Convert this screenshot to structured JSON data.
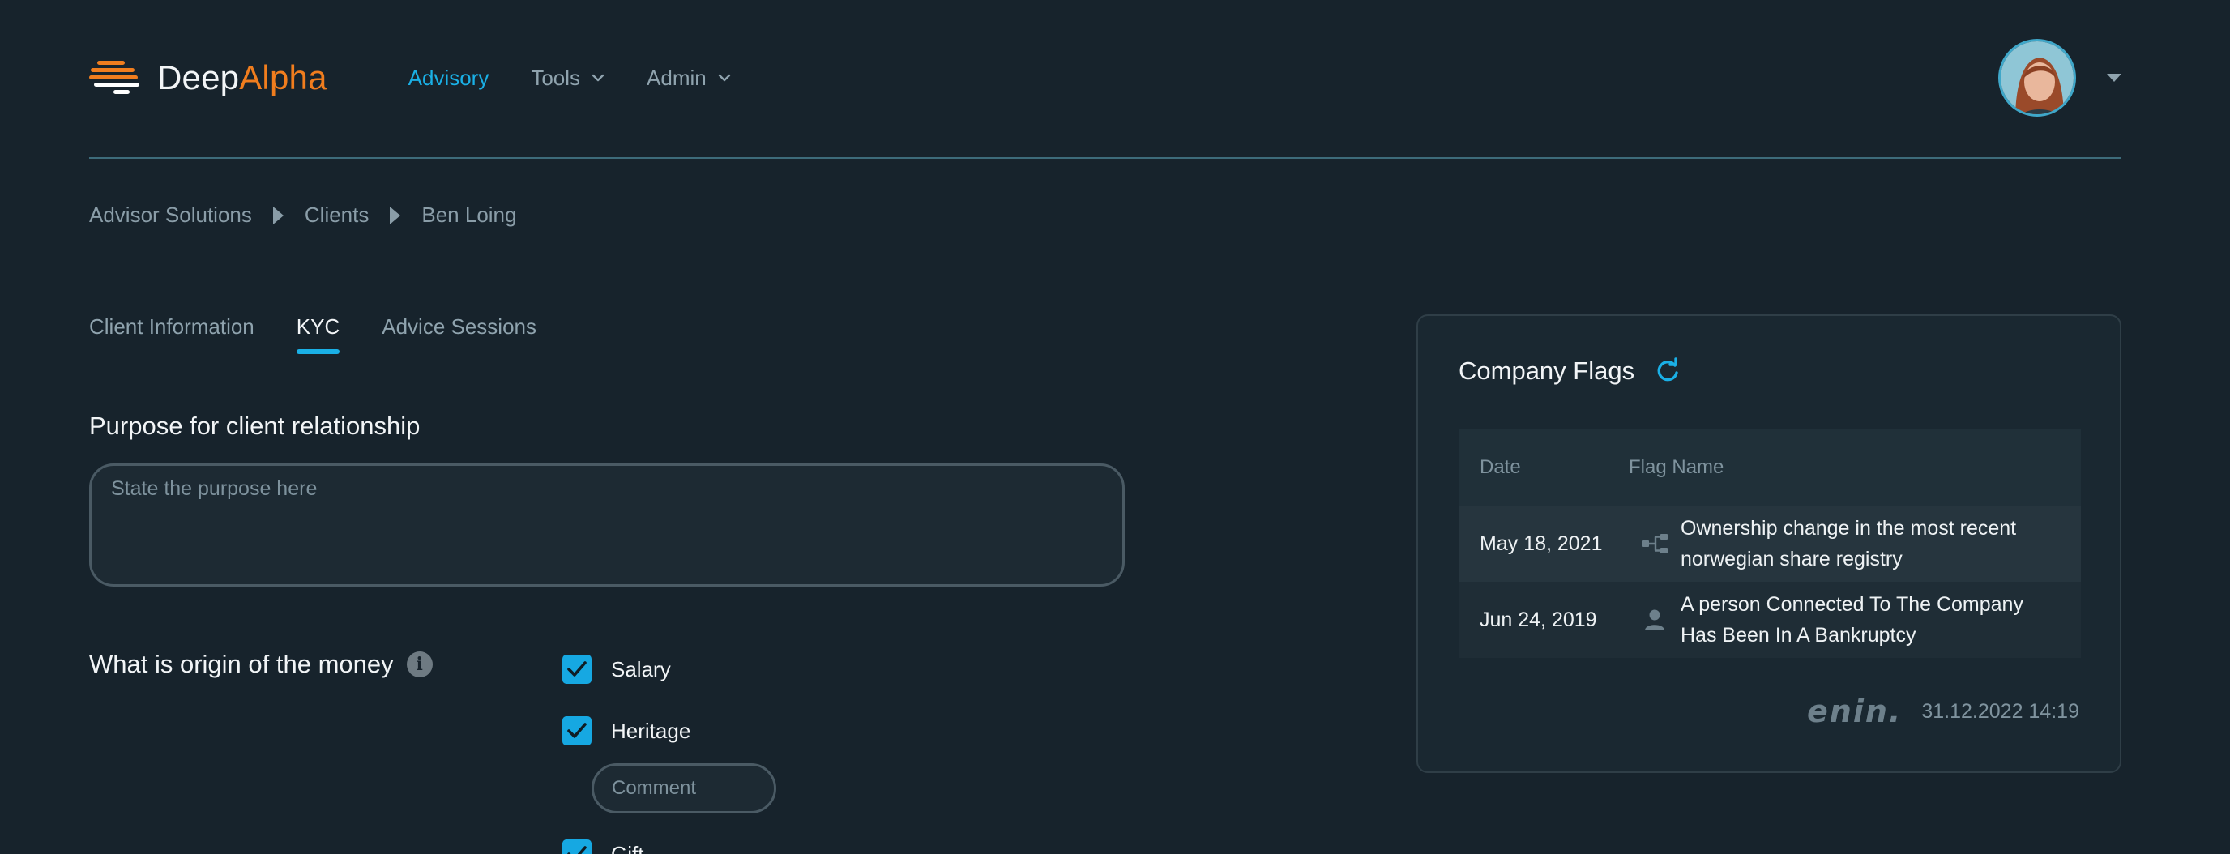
{
  "brand": {
    "name_part1": "Deep",
    "name_part2": "Alpha",
    "accent": "#f07d1e"
  },
  "nav": {
    "items": [
      {
        "label": "Advisory",
        "active": true,
        "has_menu": false
      },
      {
        "label": "Tools",
        "active": false,
        "has_menu": true
      },
      {
        "label": "Admin",
        "active": false,
        "has_menu": true
      }
    ],
    "accent": "#1ab0e6"
  },
  "user": {
    "avatar_icon": "user-avatar",
    "menu_icon": "caret-down-icon"
  },
  "breadcrumb": [
    "Advisor Solutions",
    "Clients",
    "Ben Loing"
  ],
  "tabs": [
    {
      "label": "Client Information",
      "active": false
    },
    {
      "label": "KYC",
      "active": true
    },
    {
      "label": "Advice Sessions",
      "active": false
    }
  ],
  "purpose": {
    "title": "Purpose for client relationship",
    "placeholder": "State the purpose here",
    "value": ""
  },
  "origin": {
    "title": "What is origin of the money",
    "info_icon": "info-icon",
    "options": [
      {
        "label": "Salary",
        "checked": true
      },
      {
        "label": "Heritage",
        "checked": true
      },
      {
        "label": "Gift",
        "checked": true
      }
    ],
    "comment_placeholder": "Comment"
  },
  "company_flags": {
    "title": "Company Flags",
    "refresh_icon": "refresh-icon",
    "columns": [
      "Date",
      "Flag Name"
    ],
    "rows": [
      {
        "date": "May 18, 2021",
        "icon": "ownership-tree-icon",
        "name_line1": "Ownership change in the most recent",
        "name_line2": "norwegian share registry"
      },
      {
        "date": "Jun 24, 2019",
        "icon": "person-icon",
        "name_line1": "A person Connected To The Company",
        "name_line2": "Has Been In A Bankruptcy"
      }
    ],
    "source_logo": "enin.",
    "timestamp": "31.12.2022 14:19"
  }
}
